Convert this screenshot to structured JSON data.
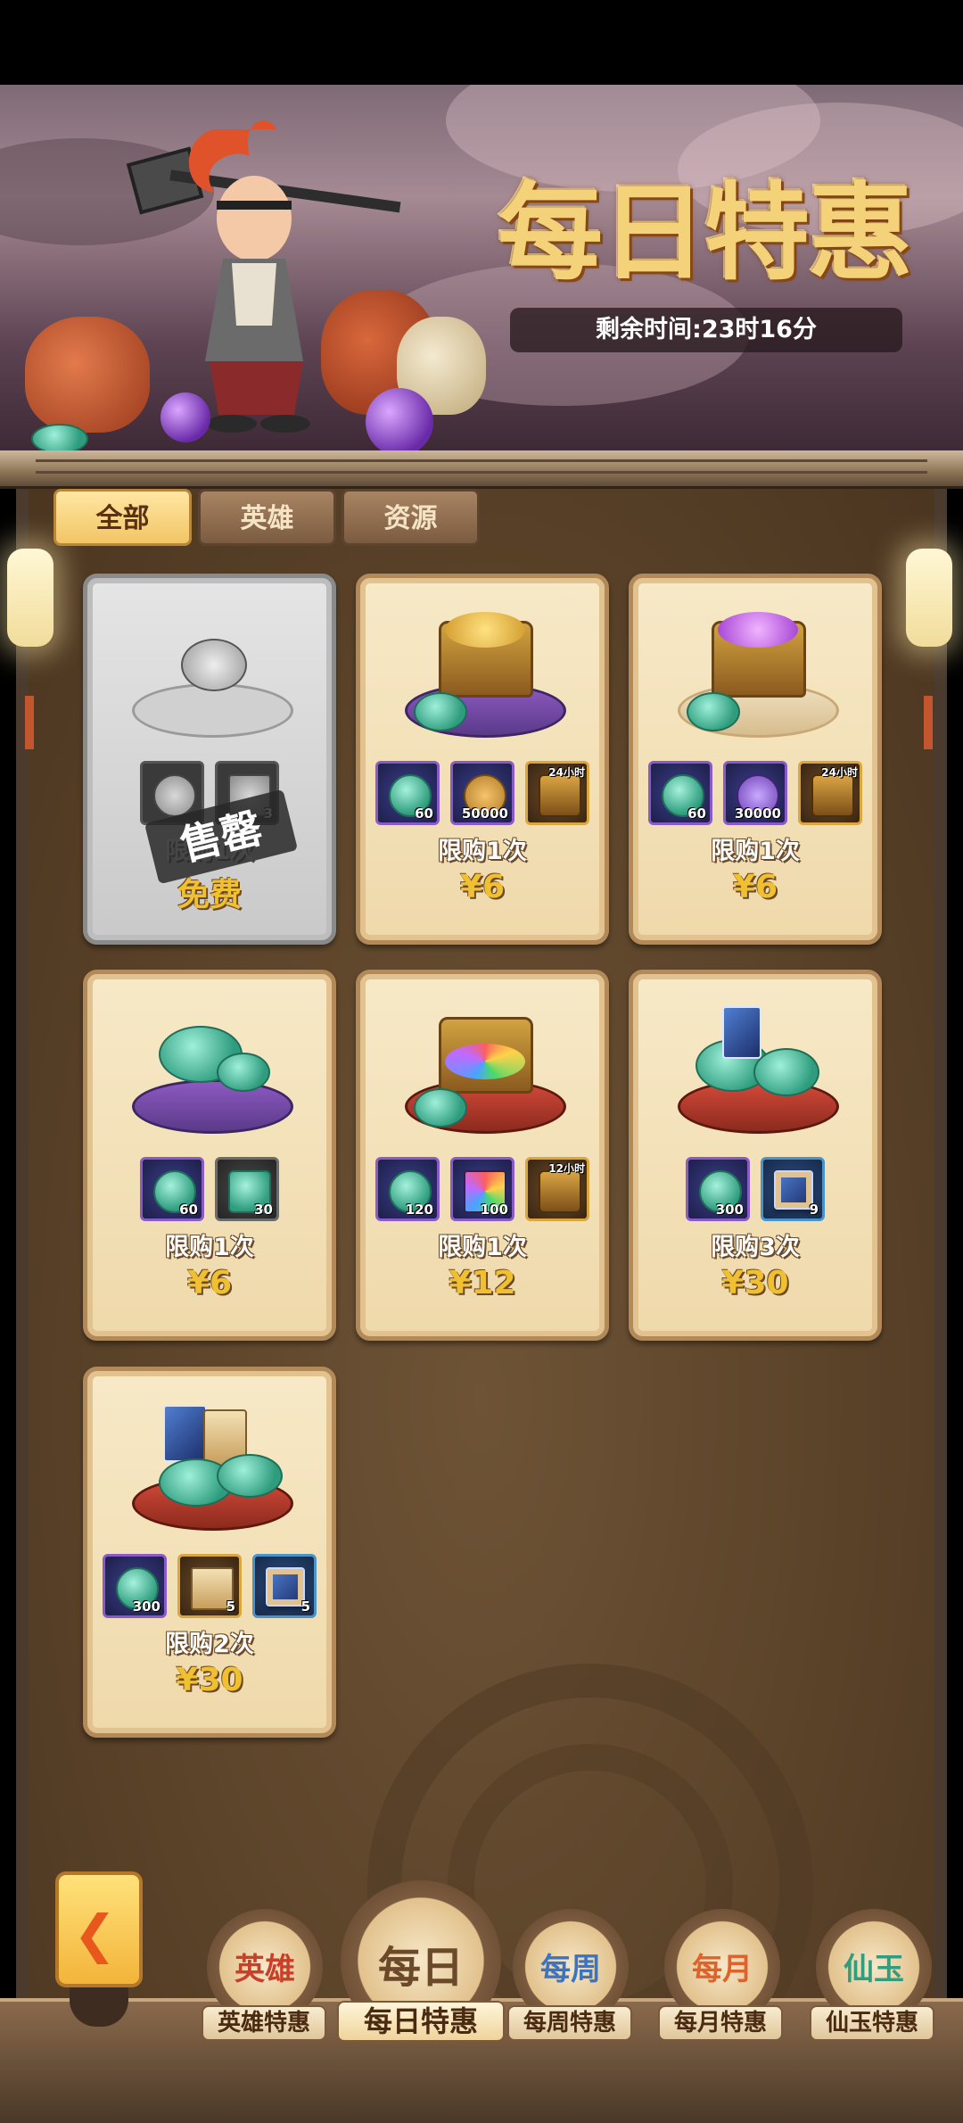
{
  "header": {
    "title": "每日特惠",
    "timer": "剩余时间:23时16分"
  },
  "tabs": [
    {
      "label": "全部",
      "active": true
    },
    {
      "label": "英雄",
      "active": false
    },
    {
      "label": "资源",
      "active": false
    }
  ],
  "cards": [
    {
      "limit": "限购1次",
      "price": "免费",
      "sold_stamp": "售罄",
      "sold": true,
      "items": [
        {
          "icon": "silver-coin-icon",
          "qty": ""
        },
        {
          "icon": "hammer-icon",
          "qty": "3"
        }
      ]
    },
    {
      "limit": "限购1次",
      "price": "¥6",
      "items": [
        {
          "icon": "jade-coin-icon",
          "qty": "60"
        },
        {
          "icon": "copper-coin-icon",
          "qty": "50000"
        },
        {
          "icon": "treasure-chest-icon",
          "badge": "24小时"
        }
      ]
    },
    {
      "limit": "限购1次",
      "price": "¥6",
      "items": [
        {
          "icon": "jade-coin-icon",
          "qty": "60"
        },
        {
          "icon": "spirit-swirl-icon",
          "qty": "30000"
        },
        {
          "icon": "treasure-chest-icon",
          "badge": "24小时"
        }
      ]
    },
    {
      "limit": "限购1次",
      "price": "¥6",
      "items": [
        {
          "icon": "jade-coin-icon",
          "qty": "60"
        },
        {
          "icon": "jade-chest-icon",
          "qty": "30"
        }
      ]
    },
    {
      "limit": "限购1次",
      "price": "¥12",
      "items": [
        {
          "icon": "jade-coin-icon",
          "qty": "120"
        },
        {
          "icon": "rainbow-star-icon",
          "qty": "100"
        },
        {
          "icon": "treasure-chest-icon",
          "badge": "12小时"
        }
      ]
    },
    {
      "limit": "限购3次",
      "price": "¥30",
      "items": [
        {
          "icon": "jade-coin-icon",
          "qty": "300"
        },
        {
          "icon": "hero-card-icon",
          "qty": "9"
        }
      ]
    },
    {
      "limit": "限购2次",
      "price": "¥30",
      "items": [
        {
          "icon": "jade-coin-icon",
          "qty": "300"
        },
        {
          "icon": "scroll-card-icon",
          "qty": "5"
        },
        {
          "icon": "blue-card-icon",
          "qty": "5"
        }
      ]
    }
  ],
  "bottom_nav": [
    {
      "label": "英雄特惠",
      "glyph": "英雄",
      "active": false
    },
    {
      "label": "每日特惠",
      "glyph": "每日",
      "active": true
    },
    {
      "label": "每周特惠",
      "glyph": "每周",
      "active": false
    },
    {
      "label": "每月特惠",
      "glyph": "每月",
      "active": false
    },
    {
      "label": "仙玉特惠",
      "glyph": "仙玉",
      "active": false
    }
  ],
  "colors": {
    "accent_gold": "#f0c030",
    "tab_active": "#f2c565",
    "card_bg": "#f7e9c7",
    "back_arrow": "#e8571c"
  }
}
